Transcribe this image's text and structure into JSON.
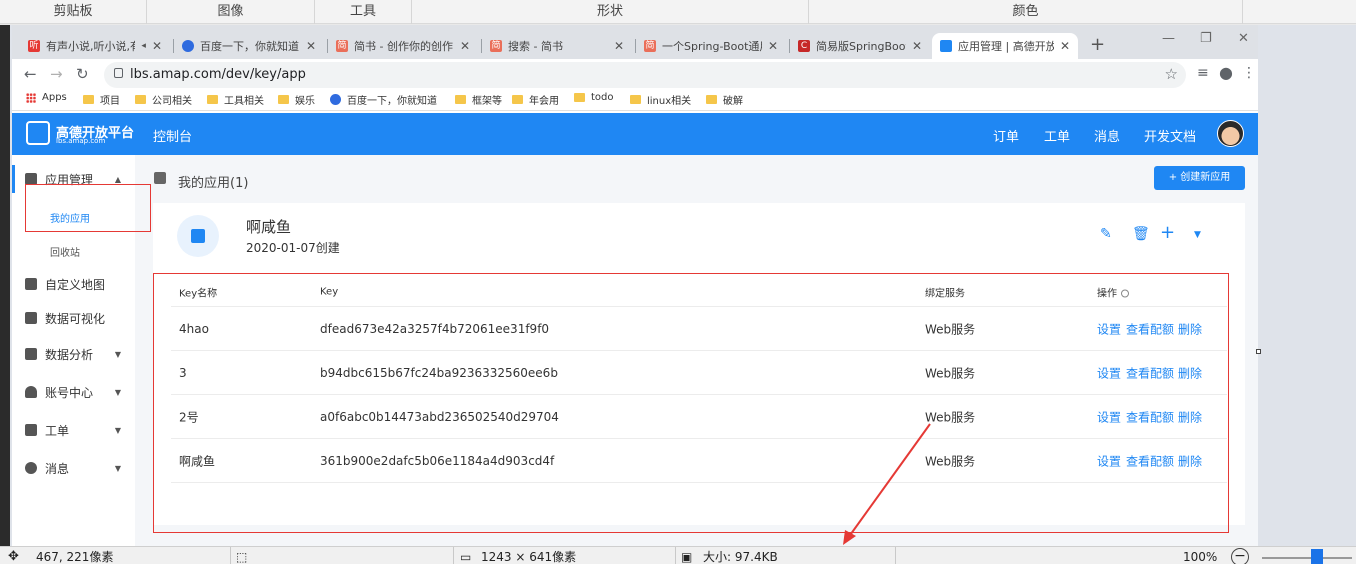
{
  "ribbon": {
    "groups": [
      "剪贴板",
      "图像",
      "工具",
      "形状",
      "颜色"
    ]
  },
  "browser": {
    "tabs": [
      {
        "title": "有声小说,听小说,有",
        "favicon_color": "#e53935",
        "favicon_text": "听",
        "extra": "◂"
      },
      {
        "title": "百度一下，你就知道",
        "favicon_color": "#2f6bdf",
        "favicon_text": ""
      },
      {
        "title": "简书 - 创作你的创作",
        "favicon_color": "#ea6f5a",
        "favicon_text": "简"
      },
      {
        "title": "搜索 - 简书",
        "favicon_color": "#ea6f5a",
        "favicon_text": "简"
      },
      {
        "title": "一个Spring-Boot通用",
        "favicon_color": "#ea6f5a",
        "favicon_text": "简"
      },
      {
        "title": "简易版SpringBoot 服",
        "favicon_color": "#c62828",
        "favicon_text": "C"
      },
      {
        "title": "应用管理 | 高德开放平",
        "favicon_color": "#1f87f3",
        "favicon_text": "",
        "active": true
      }
    ],
    "url": "lbs.amap.com/dev/key/app",
    "bookmarks": [
      {
        "label": "Apps",
        "icon": "apps-grid-icon"
      },
      {
        "label": "项目",
        "icon": "folder-icon"
      },
      {
        "label": "公司相关",
        "icon": "folder-icon"
      },
      {
        "label": "工具相关",
        "icon": "folder-icon"
      },
      {
        "label": "娱乐",
        "icon": "folder-icon"
      },
      {
        "label": "百度一下，你就知道",
        "icon": "baidu-paw-icon"
      },
      {
        "label": "框架等",
        "icon": "folder-icon"
      },
      {
        "label": "年会用",
        "icon": "folder-icon"
      },
      {
        "label": "todo",
        "icon": "folder-icon"
      },
      {
        "label": "linux相关",
        "icon": "folder-icon"
      },
      {
        "label": "破解",
        "icon": "folder-icon"
      }
    ]
  },
  "header": {
    "logo_main": "高德开放平台",
    "logo_sub": "lbs.amap.com",
    "console": "控制台",
    "nav": [
      "订单",
      "工单",
      "消息",
      "开发文档"
    ]
  },
  "sidebar": {
    "items": [
      {
        "label": "应用管理",
        "caret": "▲"
      },
      {
        "label": "自定义地图",
        "caret": ""
      },
      {
        "label": "数据可视化",
        "caret": ""
      },
      {
        "label": "数据分析",
        "caret": "▼"
      },
      {
        "label": "账号中心",
        "caret": "▼"
      },
      {
        "label": "工单",
        "caret": "▼"
      },
      {
        "label": "消息",
        "caret": "▼"
      }
    ],
    "sub_items": [
      "我的应用",
      "回收站"
    ]
  },
  "main": {
    "section_title": "我的应用(1)",
    "create_button": "+ 创建新应用",
    "app": {
      "name": "啊咸鱼",
      "created": "2020-01-07创建"
    },
    "table": {
      "headers": [
        "Key名称",
        "Key",
        "绑定服务",
        "操作"
      ],
      "rows": [
        {
          "name": "4hao",
          "key": "dfead673e42a3257f4b72061ee31f9f0",
          "service": "Web服务"
        },
        {
          "name": "3",
          "key": "b94dbc615b67fc24ba9236332560ee6b",
          "service": "Web服务"
        },
        {
          "name": "2号",
          "key": "a0f6abc0b14473abd236502540d29704",
          "service": "Web服务"
        },
        {
          "name": "啊咸鱼",
          "key": "361b900e2dafc5b06e1184a4d903cd4f",
          "service": "Web服务"
        }
      ],
      "actions": [
        "设置",
        "查看配额",
        "删除"
      ]
    }
  },
  "statusbar": {
    "cursor": "467, 221像素",
    "size": "1243 × 641像素",
    "filesize": "大小: 97.4KB",
    "zoom": "100%"
  },
  "colors": {
    "brand": "#1f87f3",
    "annotation": "#e53935"
  }
}
